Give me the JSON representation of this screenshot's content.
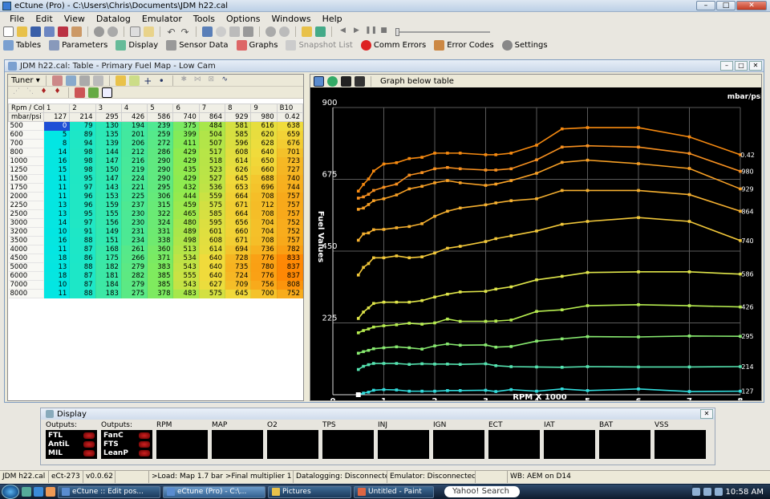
{
  "window": {
    "title": "eCtune (Pro) - C:\\Users\\Chris\\Documents\\JDM h22.cal"
  },
  "menu": [
    "File",
    "Edit",
    "View",
    "Datalog",
    "Emulator",
    "Tools",
    "Options",
    "Windows",
    "Help"
  ],
  "toolbar2": {
    "tables": "Tables",
    "parameters": "Parameters",
    "display": "Display",
    "sensor_data": "Sensor Data",
    "graphs": "Graphs",
    "snapshot": "Snapshot List",
    "comm_errors": "Comm Errors",
    "error_codes": "Error Codes",
    "settings": "Settings"
  },
  "table_window": {
    "title": "JDM h22.cal: Table - Primary Fuel Map - Low Cam",
    "tuner_label": "Tuner",
    "graph_below_label": "Graph below table",
    "corner_rpm": "Rpm / Col",
    "corner_map": "mbar/psi",
    "col_ids": [
      "1",
      "2",
      "3",
      "4",
      "5",
      "6",
      "7",
      "8",
      "9",
      "B10"
    ],
    "map_values": [
      "127",
      "214",
      "295",
      "426",
      "586",
      "740",
      "864",
      "929",
      "980",
      "0.42"
    ],
    "rpm": [
      "500",
      "600",
      "700",
      "800",
      "1000",
      "1250",
      "1500",
      "1750",
      "2000",
      "2250",
      "2500",
      "3000",
      "3200",
      "3500",
      "4000",
      "4500",
      "5000",
      "6000",
      "7000",
      "8000"
    ],
    "cells": [
      [
        0,
        79,
        130,
        194,
        239,
        375,
        484,
        581,
        616,
        638
      ],
      [
        5,
        89,
        135,
        201,
        259,
        399,
        504,
        585,
        620,
        659
      ],
      [
        8,
        94,
        139,
        206,
        272,
        411,
        507,
        596,
        628,
        676
      ],
      [
        14,
        98,
        144,
        212,
        286,
        429,
        517,
        608,
        640,
        701
      ],
      [
        16,
        98,
        147,
        216,
        290,
        429,
        518,
        614,
        650,
        723
      ],
      [
        15,
        98,
        150,
        219,
        290,
        435,
        523,
        626,
        660,
        727
      ],
      [
        11,
        95,
        147,
        224,
        290,
        429,
        527,
        645,
        688,
        740
      ],
      [
        11,
        97,
        143,
        221,
        295,
        432,
        536,
        653,
        696,
        744
      ],
      [
        11,
        96,
        153,
        225,
        306,
        444,
        559,
        664,
        708,
        757
      ],
      [
        13,
        96,
        159,
        237,
        315,
        459,
        575,
        671,
        712,
        757
      ],
      [
        13,
        95,
        155,
        230,
        322,
        465,
        585,
        664,
        708,
        757
      ],
      [
        14,
        97,
        156,
        230,
        324,
        480,
        595,
        656,
        704,
        752
      ],
      [
        10,
        91,
        149,
        231,
        331,
        489,
        601,
        660,
        704,
        752
      ],
      [
        16,
        88,
        151,
        234,
        338,
        498,
        608,
        671,
        708,
        757
      ],
      [
        11,
        87,
        168,
        261,
        360,
        513,
        614,
        694,
        736,
        782
      ],
      [
        18,
        86,
        175,
        266,
        371,
        534,
        640,
        728,
        776,
        833
      ],
      [
        13,
        88,
        182,
        279,
        383,
        543,
        640,
        735,
        780,
        837
      ],
      [
        18,
        87,
        181,
        282,
        385,
        555,
        640,
        724,
        776,
        837
      ],
      [
        10,
        87,
        184,
        279,
        385,
        543,
        627,
        709,
        756,
        808
      ],
      [
        11,
        88,
        183,
        275,
        378,
        483,
        575,
        645,
        700,
        752
      ]
    ],
    "chart_data": {
      "type": "line",
      "title": "",
      "xlabel": "RPM X 1000",
      "ylabel": "Fuel Values",
      "units_label": "mbar/psi",
      "xlim": [
        0,
        8
      ],
      "ylim": [
        0,
        900
      ],
      "x_ticks": [
        "0",
        "1",
        "2",
        "3",
        "4",
        "5",
        "6",
        "7",
        "8"
      ],
      "y_ticks": [
        "225",
        "450",
        "675",
        "900"
      ],
      "grid": true,
      "x": [
        0.5,
        0.6,
        0.7,
        0.8,
        1.0,
        1.25,
        1.5,
        1.75,
        2.0,
        2.25,
        2.5,
        3.0,
        3.2,
        3.5,
        4.0,
        4.5,
        5.0,
        6.0,
        7.0,
        8.0
      ],
      "series": [
        {
          "name": "127",
          "values": [
            0,
            5,
            8,
            14,
            16,
            15,
            11,
            11,
            11,
            13,
            13,
            14,
            10,
            16,
            11,
            18,
            13,
            18,
            10,
            11
          ]
        },
        {
          "name": "214",
          "values": [
            79,
            89,
            94,
            98,
            98,
            98,
            95,
            97,
            96,
            96,
            95,
            97,
            91,
            88,
            87,
            86,
            88,
            87,
            87,
            88
          ]
        },
        {
          "name": "295",
          "values": [
            130,
            135,
            139,
            144,
            147,
            150,
            147,
            143,
            153,
            159,
            155,
            156,
            149,
            151,
            168,
            175,
            182,
            181,
            184,
            183
          ]
        },
        {
          "name": "426",
          "values": [
            194,
            201,
            206,
            212,
            216,
            219,
            224,
            221,
            225,
            237,
            230,
            230,
            231,
            234,
            261,
            266,
            279,
            282,
            279,
            275
          ]
        },
        {
          "name": "586",
          "values": [
            239,
            259,
            272,
            286,
            290,
            290,
            290,
            295,
            306,
            315,
            322,
            324,
            331,
            338,
            360,
            371,
            383,
            385,
            385,
            378
          ]
        },
        {
          "name": "740",
          "values": [
            375,
            399,
            411,
            429,
            429,
            435,
            429,
            432,
            444,
            459,
            465,
            480,
            489,
            498,
            513,
            534,
            543,
            555,
            543,
            483
          ]
        },
        {
          "name": "864",
          "values": [
            484,
            504,
            507,
            517,
            518,
            523,
            527,
            536,
            559,
            575,
            585,
            595,
            601,
            608,
            614,
            640,
            640,
            640,
            627,
            575
          ]
        },
        {
          "name": "929",
          "values": [
            581,
            585,
            596,
            608,
            614,
            626,
            645,
            653,
            664,
            671,
            664,
            656,
            660,
            671,
            694,
            728,
            735,
            724,
            709,
            645
          ]
        },
        {
          "name": "980",
          "values": [
            616,
            620,
            628,
            640,
            650,
            660,
            688,
            696,
            708,
            712,
            708,
            704,
            704,
            708,
            736,
            776,
            780,
            776,
            756,
            700
          ]
        },
        {
          "name": "0.42",
          "values": [
            638,
            659,
            676,
            701,
            723,
            727,
            740,
            744,
            757,
            757,
            757,
            752,
            752,
            757,
            782,
            833,
            837,
            837,
            808,
            752
          ]
        }
      ]
    }
  },
  "display_panel": {
    "title": "Display",
    "outputs_label": "Outputs:",
    "outputs1": [
      "FTL",
      "AntiL",
      "MIL"
    ],
    "outputs2": [
      "FanC",
      "FTS",
      "LeanP"
    ],
    "gauges": [
      "RPM",
      "MAP",
      "O2",
      "TPS",
      "INJ",
      "IGN",
      "ECT",
      "IAT",
      "BAT",
      "VSS"
    ]
  },
  "statusbar": [
    "JDM h22.cal",
    "eCt-273",
    "v0.0.62",
    "",
    ">Load: Map 1.7 bar >Final multiplier 1",
    "Datalogging: Disconnected",
    "Emulator: Disconnected",
    "",
    "WB: AEM on D14"
  ],
  "taskbar": {
    "tasks": [
      "eCtune :: Edit pos...",
      "eCtune (Pro) - C:\\...",
      "Pictures",
      "Untitled - Paint"
    ],
    "search": "Yahoo! Search",
    "clock": "10:58 AM"
  },
  "colors": {
    "grid_low": "#00e6e6",
    "grid_high": "#ff8c1a"
  }
}
